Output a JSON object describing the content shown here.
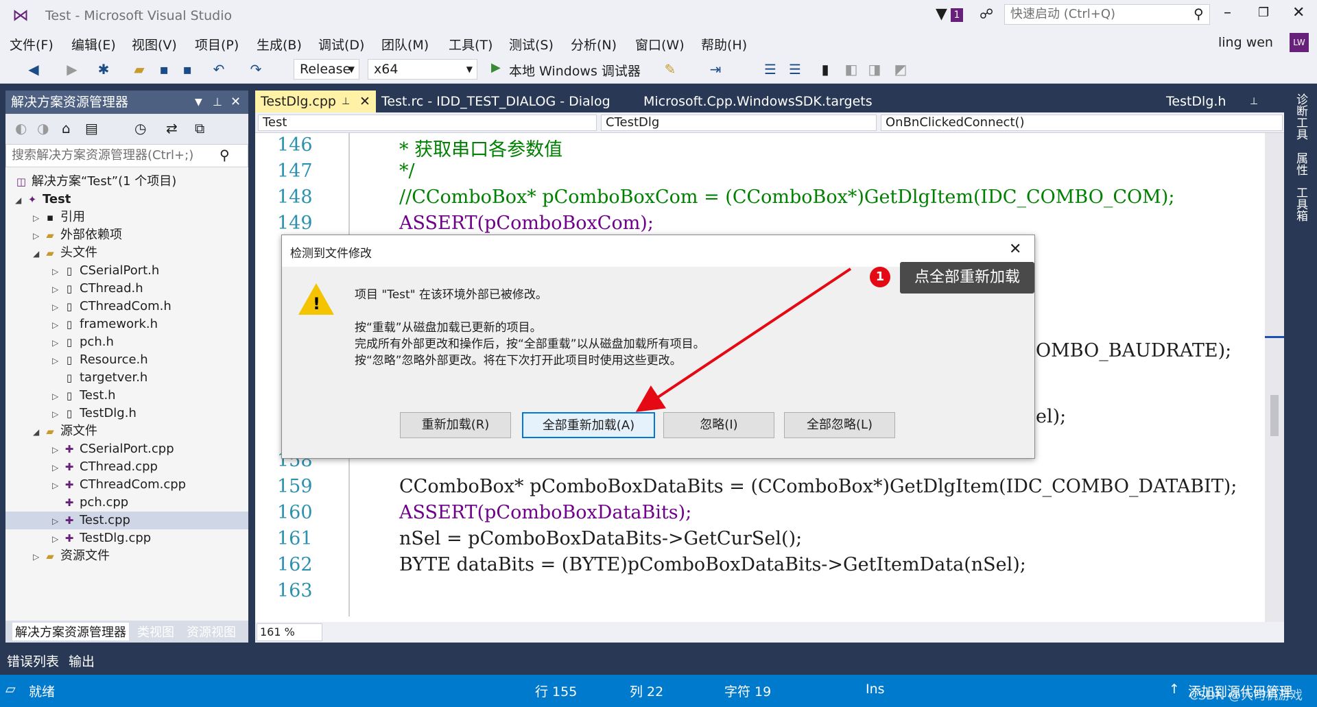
{
  "titlebar": {
    "title": "Test - Microsoft Visual Studio",
    "notifications": "1",
    "quicklaunch_placeholder": "快速启动 (Ctrl+Q)"
  },
  "menu": [
    "文件(F)",
    "编辑(E)",
    "视图(V)",
    "项目(P)",
    "生成(B)",
    "调试(D)",
    "团队(M)",
    "工具(T)",
    "测试(S)",
    "分析(N)",
    "窗口(W)",
    "帮助(H)"
  ],
  "account": {
    "name": "ling wen",
    "initials": "LW"
  },
  "toolbar": {
    "config": "Release",
    "platform": "x64",
    "run_label": "本地 Windows 调试器"
  },
  "solution_explorer": {
    "title": "解决方案资源管理器",
    "search_placeholder": "搜索解决方案资源管理器(Ctrl+;)",
    "items": [
      {
        "label": "解决方案“Test”(1 个项目)",
        "icon": "solution-icon"
      },
      {
        "label": "Test",
        "icon": "project-icon"
      },
      {
        "label": "引用",
        "icon": "references-icon"
      },
      {
        "label": "外部依赖项",
        "icon": "folder-icon"
      },
      {
        "label": "头文件",
        "icon": "folder-icon"
      },
      {
        "label": "CSerialPort.h",
        "icon": "header-file-icon"
      },
      {
        "label": "CThread.h",
        "icon": "header-file-icon"
      },
      {
        "label": "CThreadCom.h",
        "icon": "header-file-icon"
      },
      {
        "label": "framework.h",
        "icon": "header-file-icon"
      },
      {
        "label": "pch.h",
        "icon": "header-file-icon"
      },
      {
        "label": "Resource.h",
        "icon": "header-file-icon"
      },
      {
        "label": "targetver.h",
        "icon": "header-file-icon"
      },
      {
        "label": "Test.h",
        "icon": "header-file-icon"
      },
      {
        "label": "TestDlg.h",
        "icon": "header-file-icon"
      },
      {
        "label": "源文件",
        "icon": "folder-icon"
      },
      {
        "label": "CSerialPort.cpp",
        "icon": "cpp-file-icon"
      },
      {
        "label": "CThread.cpp",
        "icon": "cpp-file-icon"
      },
      {
        "label": "CThreadCom.cpp",
        "icon": "cpp-file-icon"
      },
      {
        "label": "pch.cpp",
        "icon": "cpp-file-icon"
      },
      {
        "label": "Test.cpp",
        "icon": "cpp-file-icon"
      },
      {
        "label": "TestDlg.cpp",
        "icon": "cpp-file-icon"
      },
      {
        "label": "资源文件",
        "icon": "folder-icon"
      }
    ],
    "bottom_tabs": [
      "解决方案资源管理器",
      "类视图",
      "资源视图"
    ]
  },
  "editor": {
    "tabs": [
      "TestDlg.cpp",
      "Test.rc - IDD_TEST_DIALOG - Dialog",
      "Microsoft.Cpp.WindowsSDK.targets",
      "TestDlg.h"
    ],
    "nav": {
      "project": "Test",
      "class": "CTestDlg",
      "member": "OnBnClickedConnect()"
    },
    "zoom": "161 %",
    "lines": [
      {
        "n": "146",
        "text": "* 获取串口各参数值"
      },
      {
        "n": "147",
        "text": "*/"
      },
      {
        "n": "148",
        "text": "//CComboBox* pComboBoxCom = (CComboBox*)GetDlgItem(IDC_COMBO_COM);"
      },
      {
        "n": "149",
        "text": "ASSERT(pComboBoxCom);"
      },
      {
        "n": "158",
        "text": ""
      },
      {
        "n": "159",
        "text": "CComboBox* pComboBoxDataBits = (CComboBox*)GetDlgItem(IDC_COMBO_DATABIT);"
      },
      {
        "n": "160",
        "text": "ASSERT(pComboBoxDataBits);"
      },
      {
        "n": "161",
        "text": "nSel = pComboBoxDataBits->GetCurSel();"
      },
      {
        "n": "162",
        "text": "BYTE dataBits = (BYTE)pComboBoxDataBits->GetItemData(nSel);"
      },
      {
        "n": "163",
        "text": ""
      }
    ],
    "partial1": "OMBO_BAUDRATE);",
    "partial2": "el);"
  },
  "right_strip": [
    "诊断工具",
    "属性",
    "工具箱"
  ],
  "bottom_tabs": [
    "错误列表",
    "输出"
  ],
  "statusbar": {
    "ready": "就绪",
    "line": "行 155",
    "col": "列 22",
    "char": "字符 19",
    "mode": "Ins",
    "source_control": "添加到源代码管理",
    "watermark": "CSDN @大司机游戏"
  },
  "dialog": {
    "title": "检测到文件修改",
    "message": "项目 \"Test\" 在该环境外部已被修改。",
    "line1": "按“重载”从磁盘加载已更新的项目。",
    "line2": "完成所有外部更改和操作后，按“全部重载”以从磁盘加载所有项目。",
    "line3": "按“忽略”忽略外部更改。将在下次打开此项目时使用这些更改。",
    "buttons": [
      "重新加载(R)",
      "全部重新加载(A)",
      "忽略(I)",
      "全部忽略(L)"
    ]
  },
  "annotation": {
    "badge": "1",
    "text": "点全部重新加载"
  },
  "colors": {
    "accent": "#007acc",
    "chrome": "#293955",
    "annotation_arrow": "#e50914"
  }
}
